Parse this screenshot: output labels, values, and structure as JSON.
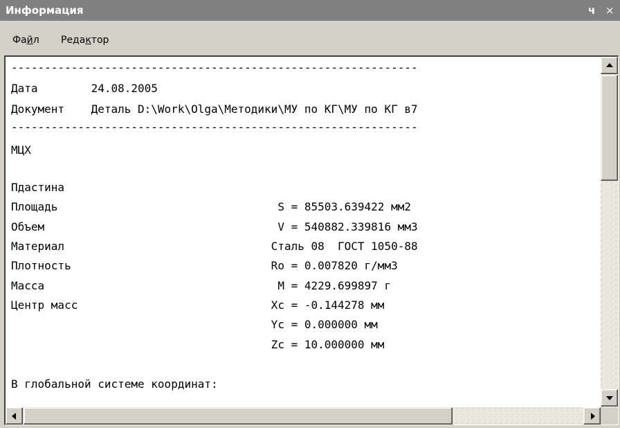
{
  "window": {
    "title": "Информация",
    "pin_glyph": "ч",
    "close_glyph": "×"
  },
  "menu": {
    "file": {
      "prefix": "Фа",
      "accel": "й",
      "suffix": "л"
    },
    "edit": {
      "prefix": "Реда",
      "accel": "к",
      "suffix": "тор"
    }
  },
  "report": {
    "lines": [
      "-------------------------------------------------------------",
      "Дата        24.08.2005",
      "Документ    Деталь D:\\Work\\Olga\\Методики\\МУ по КГ\\МУ по КГ в7",
      "-------------------------------------------------------------",
      "МЦХ",
      "",
      "Пдастина",
      "Площадь                                 S = 85503.639422 мм2",
      "Объем                                   V = 540882.339816 мм3",
      "Материал                               Сталь 08  ГОСТ 1050-88",
      "Плотность                              Ro = 0.007820 г/мм3",
      "Масса                                   M = 4229.699897 г",
      "Центр масс                             Xc = -0.144278 мм",
      "                                       Yc = 0.000000 мм",
      "                                       Zc = 10.000000 мм",
      "",
      "В глобальной системе координат:"
    ]
  },
  "scroll": {
    "vertical_position": 0.0,
    "horizontal_position": 0.0
  }
}
